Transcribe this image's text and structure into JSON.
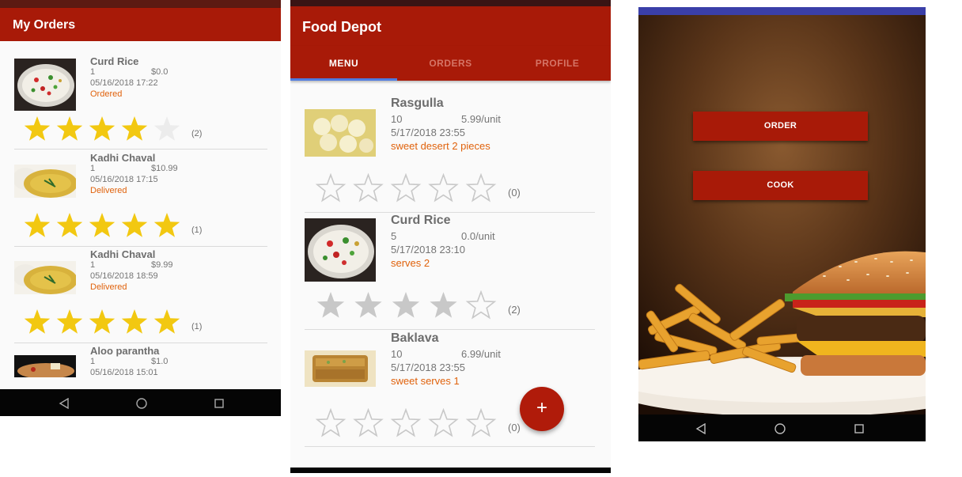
{
  "colors": {
    "primary": "#a81a08",
    "accent_orange": "#e0620c",
    "star_gold": "#f2c811",
    "star_gray": "#c8c8c8",
    "tab_indicator": "#4f7ce0"
  },
  "my_orders": {
    "title": "My Orders",
    "orders": [
      {
        "name": "Curd Rice",
        "qty": "1",
        "price": "$0.0",
        "date": "05/16/2018 17:22",
        "status": "Ordered",
        "rating": 4,
        "count": "(2)",
        "image": "curd-rice"
      },
      {
        "name": "Kadhi Chaval",
        "qty": "1",
        "price": "$10.99",
        "date": "05/16/2018 17:15",
        "status": "Delivered",
        "rating": 5,
        "count": "(1)",
        "image": "kadhi-chaval"
      },
      {
        "name": "Kadhi Chaval",
        "qty": "1",
        "price": "$9.99",
        "date": "05/16/2018 18:59",
        "status": "Delivered",
        "rating": 5,
        "count": "(1)",
        "image": "kadhi-chaval"
      },
      {
        "name": "Aloo parantha",
        "qty": "1",
        "price": "$1.0",
        "date": "05/16/2018 15:01",
        "status": "",
        "rating": 0,
        "count": "",
        "image": "aloo-parantha"
      }
    ]
  },
  "food_depot": {
    "title": "Food Depot",
    "tabs": [
      {
        "label": "MENU",
        "active": true
      },
      {
        "label": "ORDERS",
        "active": false
      },
      {
        "label": "PROFILE",
        "active": false
      }
    ],
    "items": [
      {
        "name": "Rasgulla",
        "qty": "10",
        "price": "5.99/unit",
        "date": "5/17/2018  23:55",
        "desc": "sweet desert 2 pieces",
        "rating": 0,
        "count": "(0)",
        "image": "rasgulla"
      },
      {
        "name": "Curd Rice",
        "qty": "5",
        "price": "0.0/unit",
        "date": "5/17/2018  23:10",
        "desc": "serves 2",
        "rating": 4,
        "count": "(2)",
        "image": "curd-rice"
      },
      {
        "name": "Baklava",
        "qty": "10",
        "price": "6.99/unit",
        "date": "5/17/2018  23:55",
        "desc": "sweet serves 1",
        "rating": 0,
        "count": "(0)",
        "image": "baklava"
      }
    ],
    "fab_label": "+"
  },
  "landing": {
    "order_label": "ORDER",
    "cook_label": "COOK",
    "background": "burger-and-fries-photo"
  },
  "nav": {
    "back_icon": "back-triangle-icon",
    "home_icon": "home-circle-icon",
    "recents_icon": "recents-square-icon"
  }
}
